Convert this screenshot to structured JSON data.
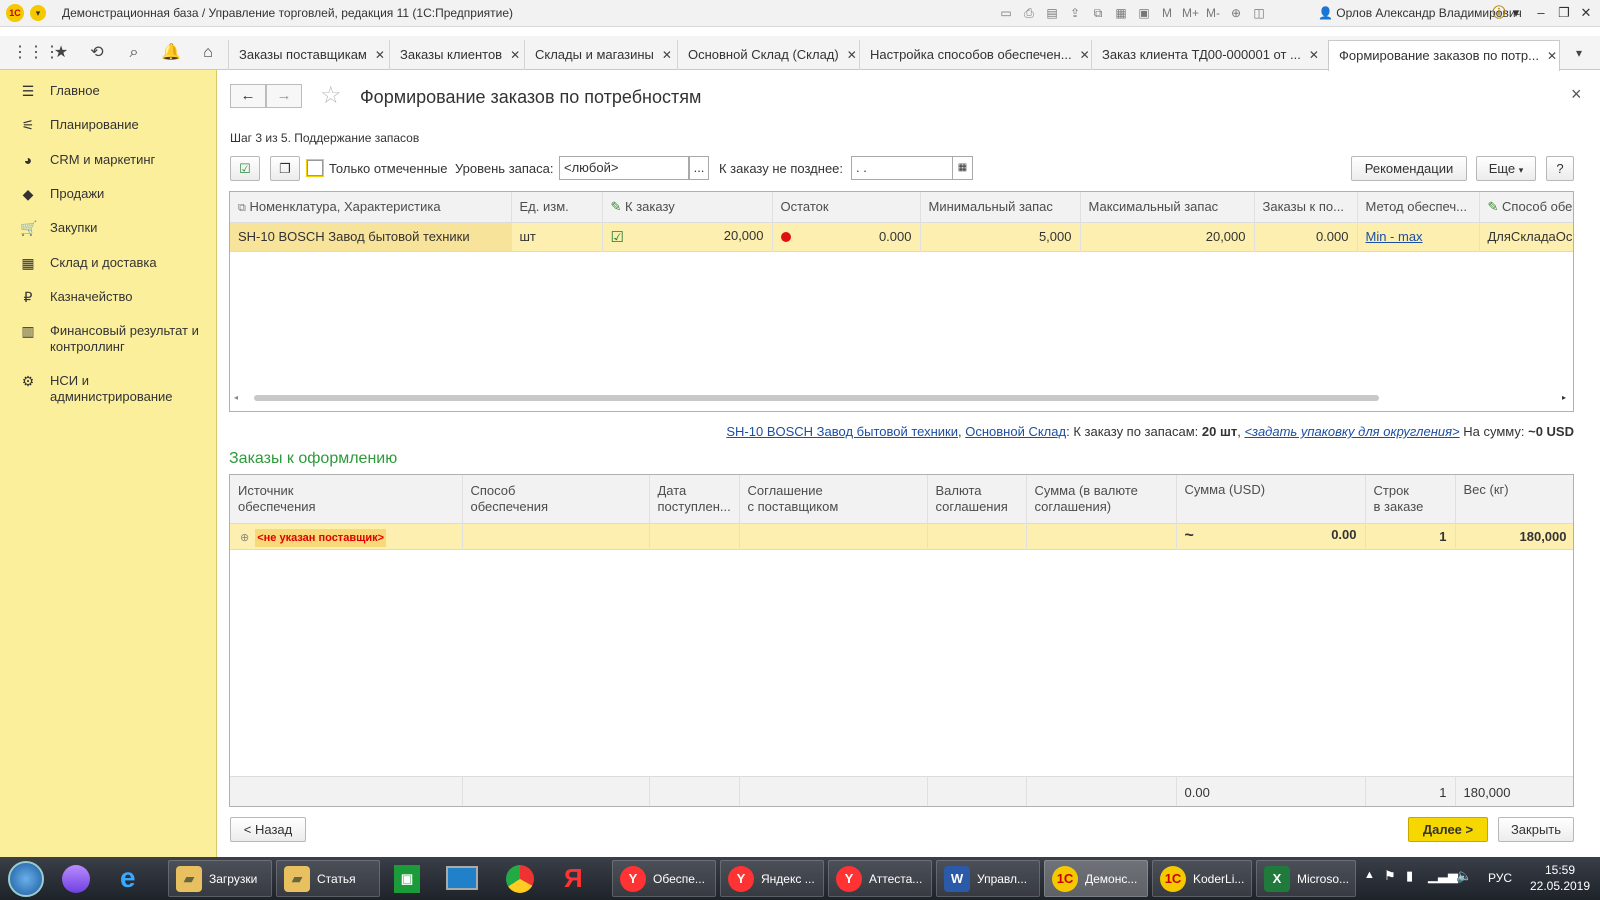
{
  "window": {
    "logo": "1С",
    "title": "Демонстрационная база / Управление торговлей, редакция 11  (1С:Предприятие)",
    "user": "Орлов Александр Владимирович",
    "minimize": "–",
    "restore": "❐",
    "close": "✕"
  },
  "tabs": [
    {
      "label": "Заказы поставщикам"
    },
    {
      "label": "Заказы клиентов"
    },
    {
      "label": "Склады и магазины"
    },
    {
      "label": "Основной Склад (Склад)"
    },
    {
      "label": "Настройка способов обеспечен..."
    },
    {
      "label": "Заказ клиента ТД00-000001 от ..."
    },
    {
      "label": "Формирование заказов по потр..."
    }
  ],
  "tab_close": "✕",
  "sidebar": {
    "items": [
      {
        "label": "Главное"
      },
      {
        "label": "Планирование"
      },
      {
        "label": "CRM и маркетинг"
      },
      {
        "label": "Продажи"
      },
      {
        "label": "Закупки"
      },
      {
        "label": "Склад и доставка"
      },
      {
        "label": "Казначейство"
      },
      {
        "label": "Финансовый результат и контроллинг"
      },
      {
        "label": "НСИ и администрирование"
      }
    ]
  },
  "form": {
    "title": "Формирование заказов по потребностям",
    "close": "×",
    "step": "Шаг 3 из 5. Поддержание запасов",
    "only_marked": "Только отмеченные",
    "stock_level_label": "Уровень запаса:",
    "stock_level_value": "<любой>",
    "select_dots": "...",
    "deadline_label": "К заказу не позднее:",
    "deadline_value": " .  .",
    "recommendations": "Рекомендации",
    "more": "Еще",
    "help": "?"
  },
  "needs_table": {
    "headers": [
      "Номенклатура, Характеристика",
      "Ед. изм.",
      "К заказу",
      "Остаток",
      "Минимальный запас",
      "Максимальный запас",
      "Заказы к по...",
      "Метод обеспеч...",
      "Способ обе"
    ],
    "rows": [
      {
        "item": "SH-10 BOSCH Завод бытовой техники",
        "unit": "шт",
        "order_qty": "20,000",
        "balance": "0.000",
        "min_stock": "5,000",
        "max_stock": "20,000",
        "orders": "0.000",
        "method": "Min - max",
        "way": "ДляСкладаОсн"
      }
    ]
  },
  "info_line": {
    "item_link": "SH-10 BOSCH Завод бытовой техники",
    "comma1": ",",
    "warehouse_link": "Основной Склад",
    "text1": ": К заказу по запасам:",
    "qty": "20 шт",
    "comma2": ",",
    "pack_link": "<задать упаковку для округления>",
    "text2": "На сумму:",
    "sum": "~0 USD"
  },
  "orders_section": {
    "title": "Заказы к оформлению",
    "headers": [
      [
        "Источник",
        "обеспечения"
      ],
      [
        "Способ",
        "обеспечения"
      ],
      [
        "Дата",
        "поступлен..."
      ],
      [
        "Соглашение",
        "с поставщиком"
      ],
      [
        "Валюта",
        "соглашения"
      ],
      [
        "Сумма (в валюте",
        "соглашения)"
      ],
      [
        "Сумма (USD)",
        ""
      ],
      [
        "Строк",
        "в заказе"
      ],
      [
        "Вес (кг)",
        ""
      ]
    ],
    "row": {
      "expand": "⊕",
      "supplier": "<не указан поставщик>",
      "approx": "~",
      "sum_usd": "0.00",
      "lines": "1",
      "weight": "180,000"
    },
    "totals": {
      "sum_usd": "0.00",
      "lines": "1",
      "weight": "180,000"
    }
  },
  "footer": {
    "back": "< Назад",
    "next": "Далее >",
    "close": "Закрыть"
  },
  "taskbar": {
    "items": [
      {
        "label": "Загрузки"
      },
      {
        "label": "Статья"
      },
      {
        "label": "Обеспе..."
      },
      {
        "label": "Яндекс ..."
      },
      {
        "label": "Аттеста..."
      },
      {
        "label": "Управл..."
      },
      {
        "label": "Демонс..."
      },
      {
        "label": "KoderLi..."
      },
      {
        "label": "Microso..."
      }
    ],
    "lang": "РУС",
    "time": "15:59",
    "date": "22.05.2019"
  },
  "colors": {
    "sidebar": "#fbef9c",
    "selected_row": "#fcefb0",
    "section_title": "#2e9a3b",
    "primary_button": "#f6d800",
    "link": "#1c4fa3",
    "warning_text": "#e00000"
  }
}
